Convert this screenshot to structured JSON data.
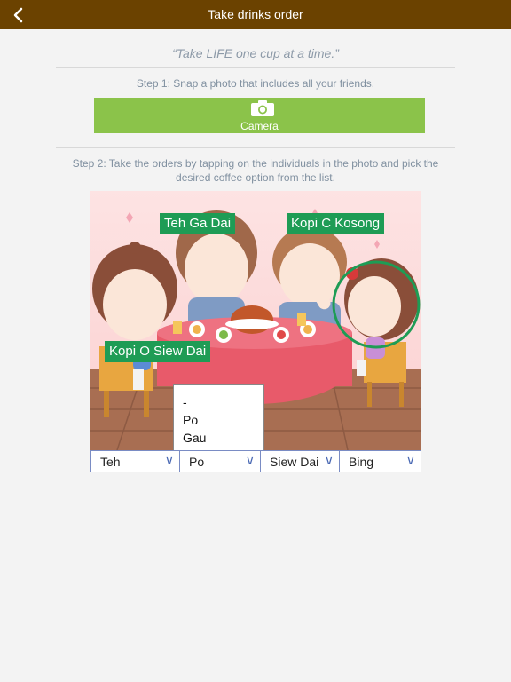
{
  "navbar": {
    "title": "Take drinks order",
    "back_icon": "chevron-left-icon"
  },
  "motto": "“Take LIFE one cup at a time.”",
  "step1": {
    "text": "Step 1: Snap a photo that includes all your friends."
  },
  "camera_button": {
    "label": "Camera",
    "icon": "camera-icon"
  },
  "step2": {
    "text": "Step 2: Take the orders by tapping on the individuals in the photo and pick the desired coffee option from the list."
  },
  "order_tags": [
    "Teh Ga Dai",
    "Kopi C Kosong",
    "Kopi O Siew Dai"
  ],
  "picker_options": [
    "-",
    "Po",
    "Gau"
  ],
  "dropdowns": [
    {
      "value": "Teh"
    },
    {
      "value": "Po"
    },
    {
      "value": "Siew Dai"
    },
    {
      "value": "Bing"
    }
  ],
  "dropdown_arrow": "∨",
  "colors": {
    "navbar": "#6b4200",
    "camera_button": "#8bc34a",
    "order_tag": "#1e9c55",
    "selection_ring": "#1e9c55",
    "background": "#f3f3f3"
  }
}
